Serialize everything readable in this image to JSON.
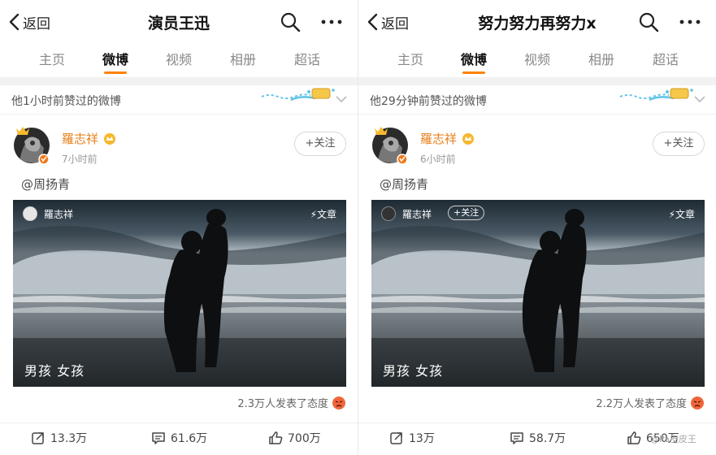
{
  "panels": [
    {
      "back_label": "返回",
      "title": "演员王迅",
      "tabs": [
        "主页",
        "微博",
        "视频",
        "相册",
        "超话"
      ],
      "active_tab": 1,
      "liked_text": "他1小时前赞过的微博",
      "post": {
        "author": "羅志祥",
        "time": "7小时前",
        "follow_label": "+关注",
        "mention": "@周扬青",
        "card": {
          "author": "羅志祥",
          "follow_label": "",
          "article_label": "⚡文章",
          "caption": "男孩 女孩"
        },
        "reactions": "2.3万人发表了态度",
        "repost": "13.3万",
        "comment": "61.6万",
        "like": "700万"
      }
    },
    {
      "back_label": "返回",
      "title": "努力努力再努力x",
      "tabs": [
        "主页",
        "微博",
        "视频",
        "相册",
        "超话"
      ],
      "active_tab": 1,
      "liked_text": "他29分钟前赞过的微博",
      "post": {
        "author": "羅志祥",
        "time": "6小时前",
        "follow_label": "+关注",
        "mention": "@周扬青",
        "card": {
          "author": "羅志祥",
          "follow_label": "+关注",
          "article_label": "⚡文章",
          "caption": "男孩 女孩"
        },
        "reactions": "2.2万人发表了态度",
        "repost": "13万",
        "comment": "58.7万",
        "like": "650万"
      }
    }
  ],
  "watermark": "@Pa皮皮王",
  "icons": {
    "back": "chevron-left-icon",
    "search": "search-icon",
    "more": "more-icon",
    "repost": "repost-icon",
    "comment": "comment-icon",
    "like": "thumbs-up-icon",
    "badge": "vip-crown-icon",
    "reaction": "angry-face-icon"
  },
  "colors": {
    "accent": "#ff8200",
    "author": "#e8801a",
    "muted": "#999999"
  }
}
